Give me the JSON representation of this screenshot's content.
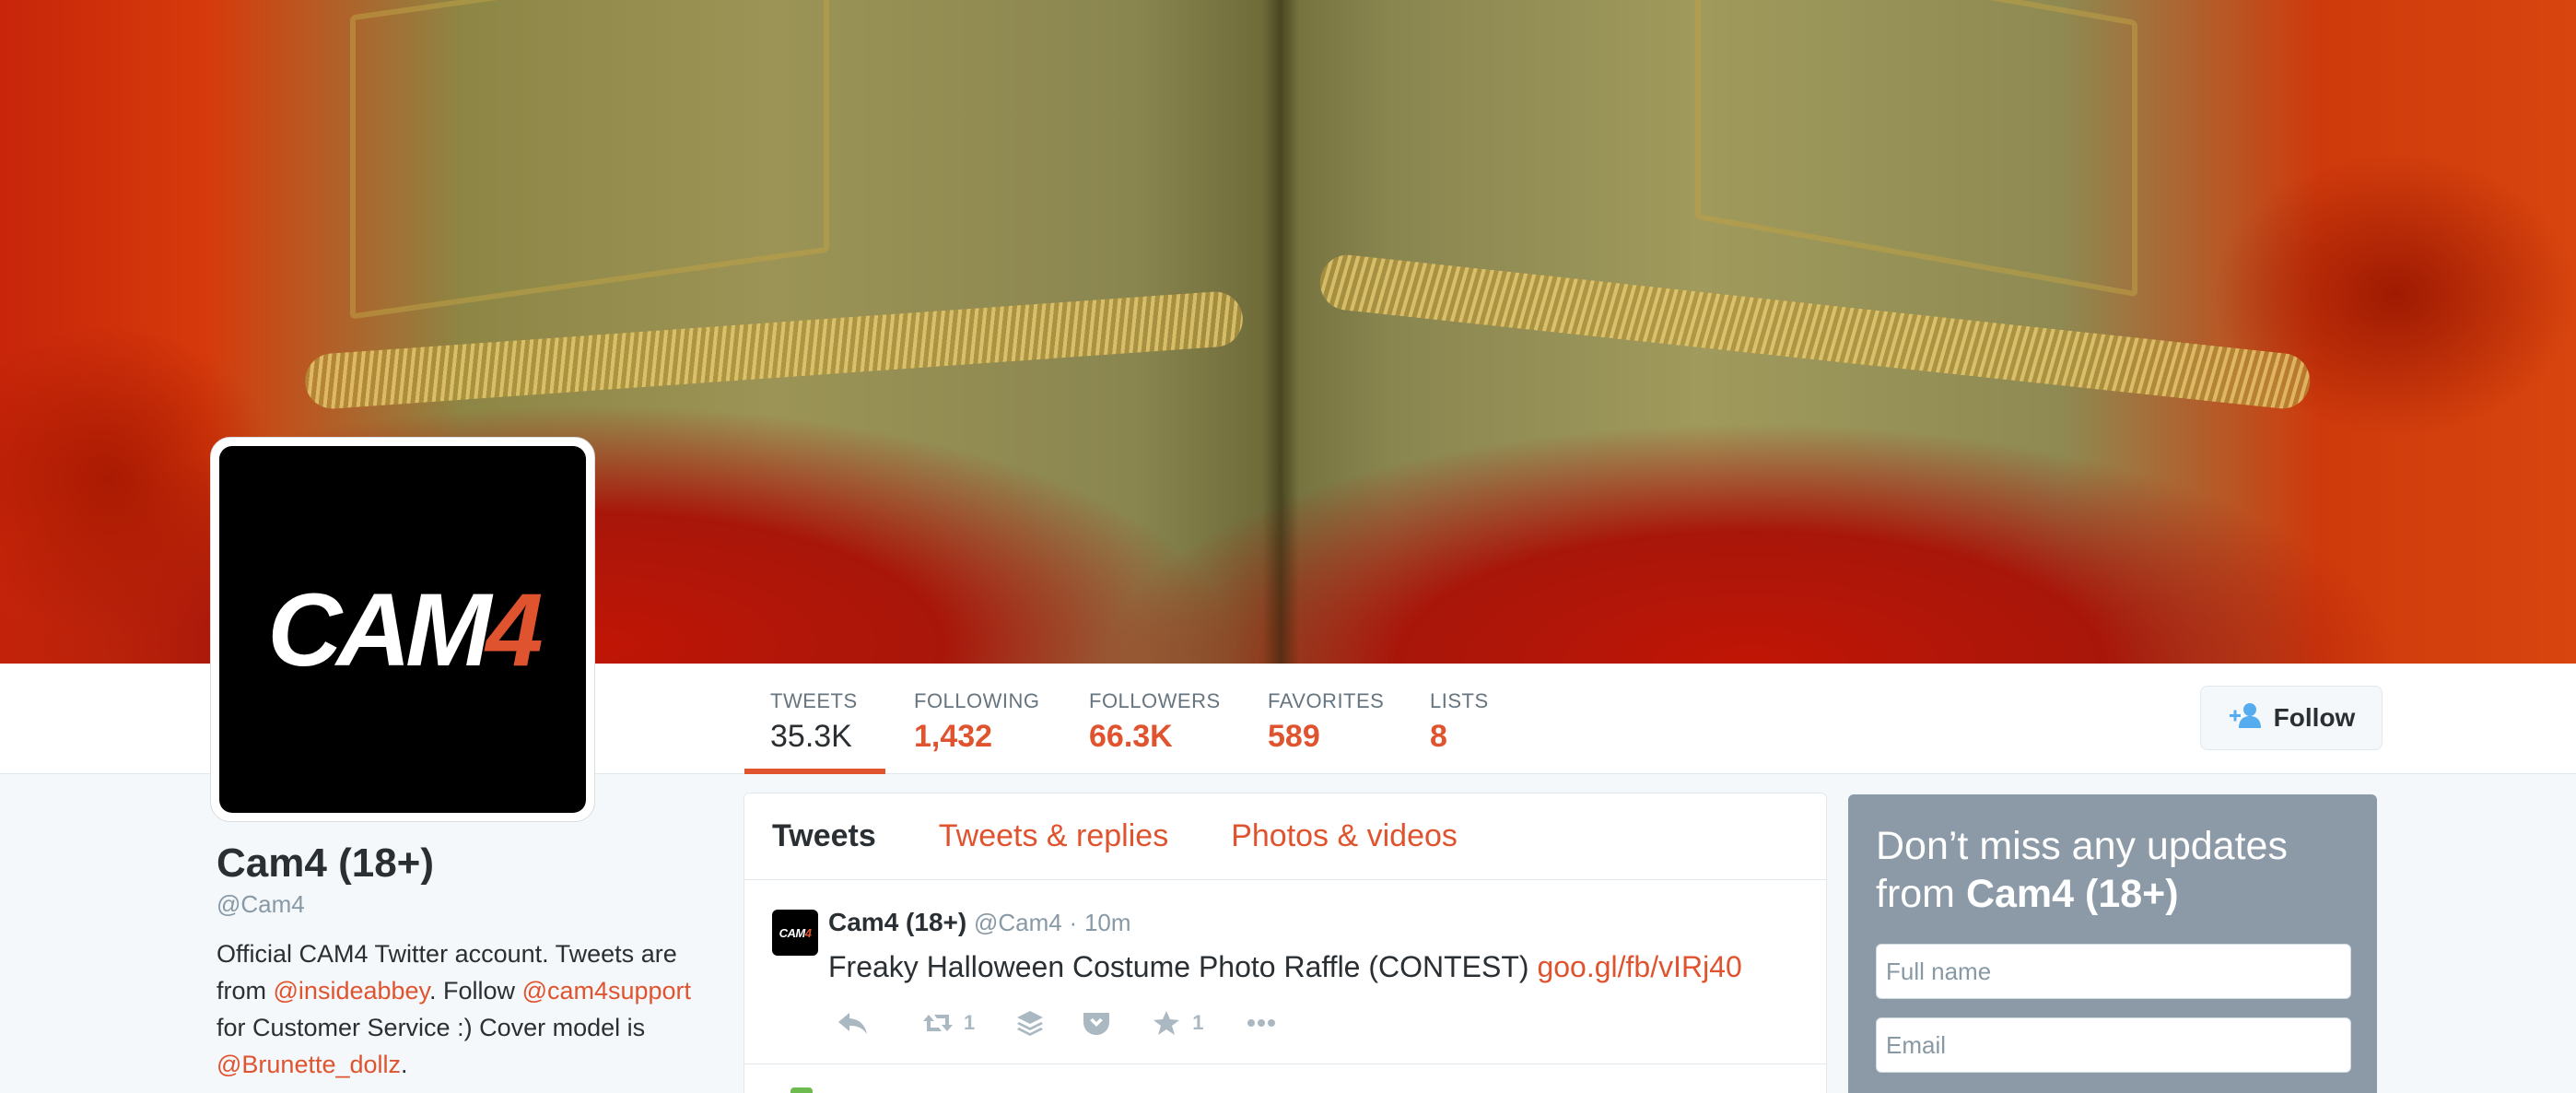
{
  "profile": {
    "display_name": "Cam4 (18+)",
    "handle": "@Cam4",
    "avatar_logo_main": "CAM",
    "avatar_logo_accent": "4",
    "bio": {
      "t1": "Official CAM4 Twitter account. Tweets are from ",
      "m1": "@insideabbey",
      "t2": ". Follow ",
      "m2": "@cam4support",
      "t3": " for Customer Service :) Cover model is ",
      "m3": "@Brunette_dollz",
      "t4": "."
    }
  },
  "stats": [
    {
      "label": "TWEETS",
      "value": "35.3K"
    },
    {
      "label": "FOLLOWING",
      "value": "1,432"
    },
    {
      "label": "FOLLOWERS",
      "value": "66.3K"
    },
    {
      "label": "FAVORITES",
      "value": "589"
    },
    {
      "label": "LISTS",
      "value": "8"
    }
  ],
  "follow_button": {
    "label": "Follow"
  },
  "timeline": {
    "tabs": [
      "Tweets",
      "Tweets & replies",
      "Photos & videos"
    ],
    "tweet": {
      "avatar_main": "CAM",
      "avatar_accent": "4",
      "name": "Cam4 (18+)",
      "handle": "@Cam4",
      "separator": "·",
      "time": "10m",
      "text": "Freaky Halloween Costume Photo Raffle (CONTEST) ",
      "link": "goo.gl/fb/vIRj40",
      "retweet_count": "1",
      "favorite_count": "1"
    }
  },
  "signup": {
    "title_prefix": "Don’t miss any updates from ",
    "title_name": "Cam4 (18+)",
    "full_name_placeholder": "Full name",
    "email_placeholder": "Email"
  },
  "colors": {
    "accent": "#e0532f",
    "text": "#292f33",
    "muted": "#8899a6",
    "signup_bg": "#8b9aa6"
  }
}
